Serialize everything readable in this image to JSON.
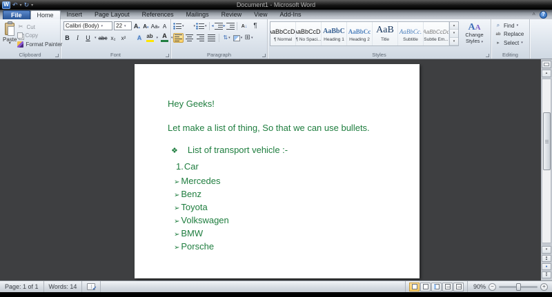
{
  "window": {
    "title": "Document1 - Microsoft Word",
    "help": "?"
  },
  "icons": {
    "word_logo": "W",
    "undo": "↶",
    "redo": "↻",
    "dropdown": "▾",
    "up_arrow": "▴",
    "down_arrow": "▾",
    "collapse_ribbon": "˄",
    "cut": "✂",
    "pilcrow": "¶",
    "updown": "⇅",
    "borders": "⊞",
    "sort_letter": "A",
    "sort_arrow": "↓",
    "find": "⌕",
    "replace_ab": "ab",
    "select_arrow": "▸",
    "check": "✓",
    "minus": "−",
    "plus": "+",
    "dot": "●",
    "left_arrow": "◂",
    "right_arrow": "▸"
  },
  "tabs": [
    {
      "label": "File"
    },
    {
      "label": "Home"
    },
    {
      "label": "Insert"
    },
    {
      "label": "Page Layout"
    },
    {
      "label": "References"
    },
    {
      "label": "Mailings"
    },
    {
      "label": "Review"
    },
    {
      "label": "View"
    },
    {
      "label": "Add-Ins"
    }
  ],
  "ribbon": {
    "clipboard": {
      "group_label": "Clipboard",
      "paste": "Paste",
      "cut": "Cut",
      "copy": "Copy",
      "format_painter": "Format Painter"
    },
    "font": {
      "group_label": "Font",
      "family": "Calibri (Body)",
      "size": "22",
      "grow": "A",
      "shrink": "A",
      "change_case": "Aa",
      "clear_format": "A",
      "bold": "B",
      "italic": "I",
      "underline": "U",
      "strikethrough": "abc",
      "subscript": "x₂",
      "superscript": "x²",
      "effects": "A",
      "highlight": "ab",
      "font_color": "A"
    },
    "paragraph": {
      "group_label": "Paragraph"
    },
    "styles": {
      "group_label": "Styles",
      "items": [
        {
          "preview": "AaBbCcDc",
          "name": "¶ Normal"
        },
        {
          "preview": "AaBbCcDc",
          "name": "¶ No Spaci..."
        },
        {
          "preview": "AaBbC",
          "name": "Heading 1"
        },
        {
          "preview": "AaBbCc",
          "name": "Heading 2"
        },
        {
          "preview": "AaB",
          "name": "Title"
        },
        {
          "preview": "AaBbCc.",
          "name": "Subtitle"
        },
        {
          "preview": "AaBbCcDc",
          "name": "Subtle Em..."
        }
      ],
      "change_styles_line1": "Change",
      "change_styles_line2": "Styles"
    },
    "editing": {
      "group_label": "Editing",
      "find": "Find",
      "replace": "Replace",
      "select": "Select"
    }
  },
  "document": {
    "text_color": "#1e7d3e",
    "line1": "Hey Geeks!",
    "line2": "Let make a list of thing, So that we can use bullets.",
    "diamond_bullet": "❖",
    "diamond_item": "List of transport vehicle :-",
    "number_label": "1.",
    "numbered_item": "Car",
    "arrow_bullet": "➢",
    "arrow_items": [
      "Mercedes",
      "Benz",
      "Toyota",
      "Volkswagen",
      "BMW",
      "Porsche"
    ]
  },
  "status_bar": {
    "page": "Page: 1 of 1",
    "words": "Words: 14",
    "zoom_level": "90%"
  }
}
